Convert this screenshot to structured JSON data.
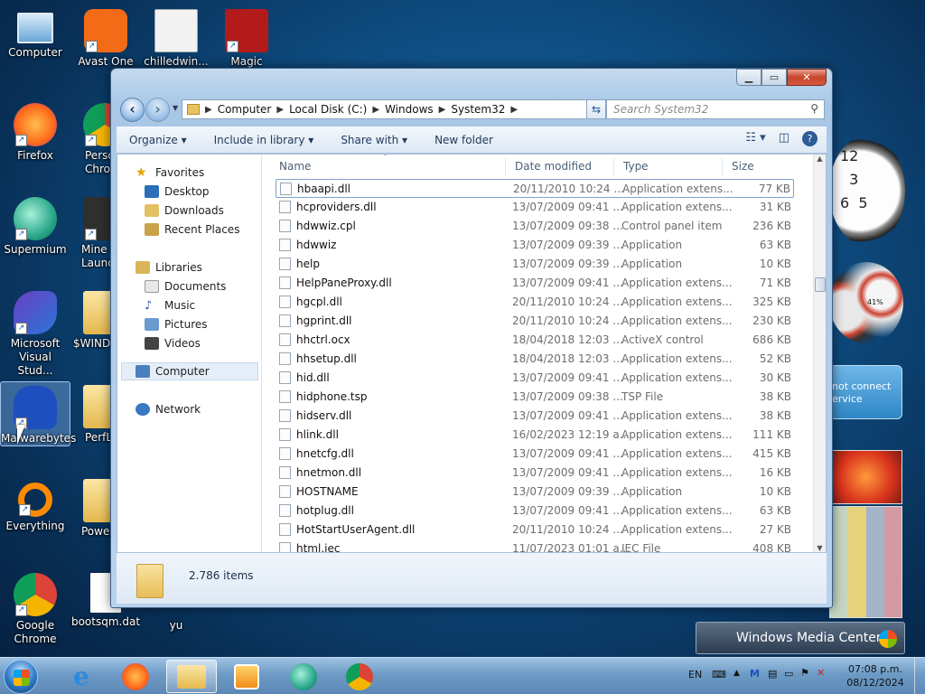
{
  "desktop": {
    "icons": [
      {
        "label": "Computer"
      },
      {
        "label": "Avast One"
      },
      {
        "label": "chilledwin..."
      },
      {
        "label": "Magic"
      },
      {
        "label": "Firefox"
      },
      {
        "label": "Perso Chro"
      },
      {
        "label": "Supermium"
      },
      {
        "label": "Mine Launc"
      },
      {
        "label": "Microsoft Visual Stud..."
      },
      {
        "label": "$WINDO"
      },
      {
        "label": "Malwarebytes"
      },
      {
        "label": "PerfL"
      },
      {
        "label": "Everything"
      },
      {
        "label": "Power"
      },
      {
        "label": "Google Chrome"
      },
      {
        "label": "bootsqm.dat"
      },
      {
        "label": "yu"
      }
    ],
    "gadget_text": {
      "error_line1": "not connect",
      "error_line2": "ervice",
      "cpu_percent": "41%",
      "wmc_title": "Windows Media Center"
    }
  },
  "window": {
    "address": [
      "Computer",
      "Local Disk (C:)",
      "Windows",
      "System32"
    ],
    "search_placeholder": "Search System32",
    "toolbar": {
      "organize": "Organize",
      "include": "Include in library",
      "share": "Share with",
      "new_folder": "New folder"
    },
    "nav": {
      "favorites": "Favorites",
      "desktop": "Desktop",
      "downloads": "Downloads",
      "recent": "Recent Places",
      "libraries": "Libraries",
      "documents": "Documents",
      "music": "Music",
      "pictures": "Pictures",
      "videos": "Videos",
      "computer": "Computer",
      "network": "Network"
    },
    "columns": {
      "name": "Name",
      "date": "Date modified",
      "type": "Type",
      "size": "Size"
    },
    "files": [
      {
        "name": "hbaapi.dll",
        "date": "20/11/2010 10:24 ...",
        "type": "Application extens...",
        "size": "77 KB"
      },
      {
        "name": "hcproviders.dll",
        "date": "13/07/2009 09:41 ...",
        "type": "Application extens...",
        "size": "31 KB"
      },
      {
        "name": "hdwwiz.cpl",
        "date": "13/07/2009 09:38 ...",
        "type": "Control panel item",
        "size": "236 KB"
      },
      {
        "name": "hdwwiz",
        "date": "13/07/2009 09:39 ...",
        "type": "Application",
        "size": "63 KB"
      },
      {
        "name": "help",
        "date": "13/07/2009 09:39 ...",
        "type": "Application",
        "size": "10 KB"
      },
      {
        "name": "HelpPaneProxy.dll",
        "date": "13/07/2009 09:41 ...",
        "type": "Application extens...",
        "size": "71 KB"
      },
      {
        "name": "hgcpl.dll",
        "date": "20/11/2010 10:24 ...",
        "type": "Application extens...",
        "size": "325 KB"
      },
      {
        "name": "hgprint.dll",
        "date": "20/11/2010 10:24 ...",
        "type": "Application extens...",
        "size": "230 KB"
      },
      {
        "name": "hhctrl.ocx",
        "date": "18/04/2018 12:03 ...",
        "type": "ActiveX control",
        "size": "686 KB"
      },
      {
        "name": "hhsetup.dll",
        "date": "18/04/2018 12:03 ...",
        "type": "Application extens...",
        "size": "52 KB"
      },
      {
        "name": "hid.dll",
        "date": "13/07/2009 09:41 ...",
        "type": "Application extens...",
        "size": "30 KB"
      },
      {
        "name": "hidphone.tsp",
        "date": "13/07/2009 09:38 ...",
        "type": "TSP File",
        "size": "38 KB"
      },
      {
        "name": "hidserv.dll",
        "date": "13/07/2009 09:41 ...",
        "type": "Application extens...",
        "size": "38 KB"
      },
      {
        "name": "hlink.dll",
        "date": "16/02/2023 12:19 a...",
        "type": "Application extens...",
        "size": "111 KB"
      },
      {
        "name": "hnetcfg.dll",
        "date": "13/07/2009 09:41 ...",
        "type": "Application extens...",
        "size": "415 KB"
      },
      {
        "name": "hnetmon.dll",
        "date": "13/07/2009 09:41 ...",
        "type": "Application extens...",
        "size": "16 KB"
      },
      {
        "name": "HOSTNAME",
        "date": "13/07/2009 09:39 ...",
        "type": "Application",
        "size": "10 KB"
      },
      {
        "name": "hotplug.dll",
        "date": "13/07/2009 09:41 ...",
        "type": "Application extens...",
        "size": "63 KB"
      },
      {
        "name": "HotStartUserAgent.dll",
        "date": "20/11/2010 10:24 ...",
        "type": "Application extens...",
        "size": "27 KB"
      },
      {
        "name": "html.iec",
        "date": "11/07/2023 01:01 a...",
        "type": "IEC File",
        "size": "408 KB"
      }
    ],
    "status": "2.786 items"
  },
  "taskbar": {
    "lang": "EN",
    "time": "07:08 p.m.",
    "date": "08/12/2024"
  }
}
